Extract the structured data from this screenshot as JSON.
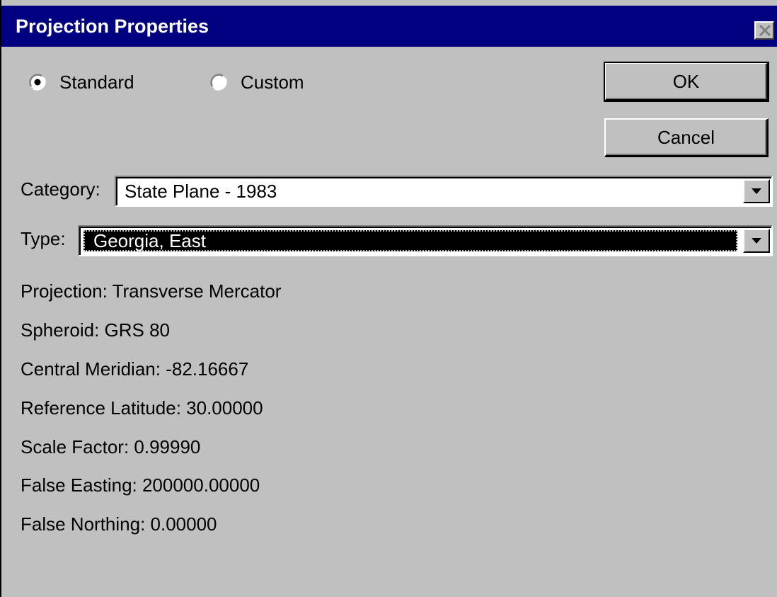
{
  "window": {
    "title": "Projection Properties",
    "close_icon": "close-x-icon"
  },
  "radios": {
    "standard": {
      "label": "Standard",
      "checked": true
    },
    "custom": {
      "label": "Custom",
      "checked": false
    }
  },
  "buttons": {
    "ok_label": "OK",
    "cancel_label": "Cancel"
  },
  "category": {
    "label": "Category:",
    "value": "State Plane - 1983"
  },
  "type": {
    "label": "Type:",
    "value": "Georgia, East"
  },
  "properties": {
    "projection": "Projection:  Transverse Mercator",
    "spheroid": "Spheroid:  GRS 80",
    "central_meridian": "Central Meridian: -82.16667",
    "reference_latitude": "Reference Latitude: 30.00000",
    "scale_factor": "Scale Factor: 0.99990",
    "false_easting": "False Easting: 200000.00000",
    "false_northing": "False Northing: 0.00000"
  },
  "colors": {
    "titlebar": "#000080",
    "face": "#c0c0c0",
    "selection": "#000000"
  }
}
